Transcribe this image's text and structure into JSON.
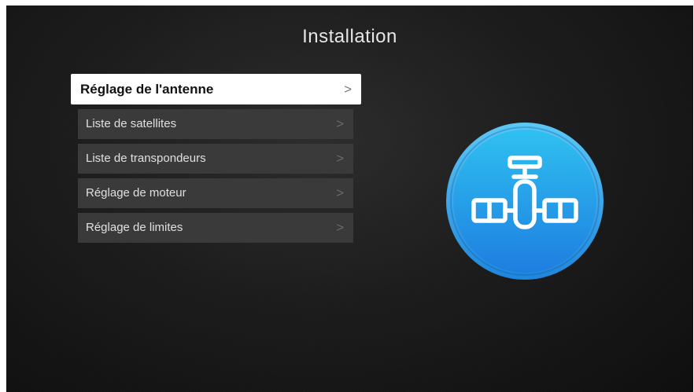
{
  "header": {
    "title": "Installation"
  },
  "menu": {
    "items": [
      {
        "label": "Réglage de l'antenne",
        "chevron": ">",
        "selected": true
      },
      {
        "label": "Liste de satellites",
        "chevron": ">",
        "selected": false
      },
      {
        "label": "Liste de transpondeurs",
        "chevron": ">",
        "selected": false
      },
      {
        "label": "Réglage de moteur",
        "chevron": ">",
        "selected": false
      },
      {
        "label": "Réglage de limites",
        "chevron": ">",
        "selected": false
      }
    ]
  },
  "illustration": {
    "icon": "satellite-icon",
    "colors": {
      "ring": "#3aaee8",
      "fill_top": "#2fc0f0",
      "fill_bottom": "#1e7ee0",
      "glyph": "#ffffff"
    }
  },
  "colors": {
    "background": "#1c1c1c",
    "item_background": "#3a3a3a",
    "selected_background": "#ffffff",
    "text": "#e0e0e0",
    "selected_text": "#111111"
  }
}
